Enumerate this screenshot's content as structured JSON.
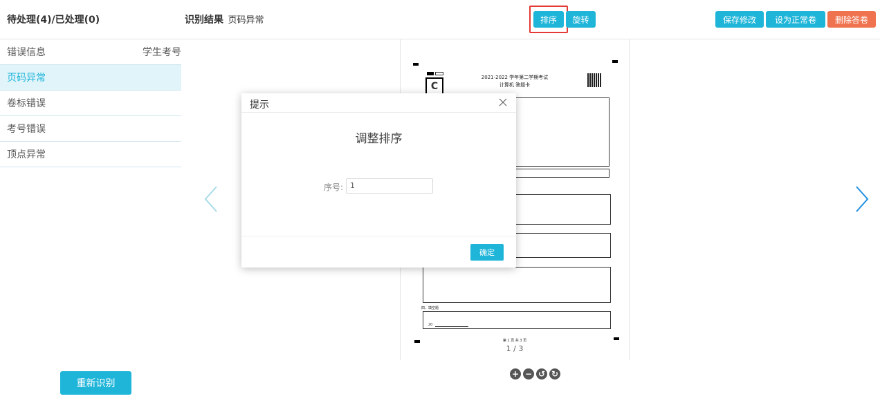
{
  "header": {
    "tabs_title": "待处理(4)/已处理(0)",
    "result_label": "识别结果",
    "result_value": "页码异常",
    "buttons": {
      "sort": "排序",
      "rotate": "旋转",
      "save": "保存修改",
      "set_normal": "设为正常卷",
      "delete": "删除答卷"
    }
  },
  "left_list": {
    "header_left": "错误信息",
    "header_right": "学生考号",
    "items": [
      "页码异常",
      "卷标错误",
      "考号错误",
      "顶点异常"
    ],
    "active_index": 0
  },
  "rerecognize_label": "重新识别",
  "preview": {
    "sheet_title_line1": "2021-2022 学年第二学期考试",
    "sheet_title_line2": "计算机 答题卡",
    "paper_letter": "C",
    "section_label": "四、填空题",
    "question_20": "20",
    "footer_page_text": "第 1 页 共 3 页",
    "pager": "1 / 3"
  },
  "zoom_controls": [
    "zoom-in",
    "zoom-out",
    "rotate-left",
    "rotate-right"
  ],
  "modal": {
    "title": "提示",
    "heading": "调整排序",
    "field_label": "序号:",
    "field_value": "1",
    "ok_label": "确定"
  },
  "colors": {
    "primary": "#1fb5d9",
    "danger": "#f0734f",
    "highlight_border": "#e53935"
  }
}
